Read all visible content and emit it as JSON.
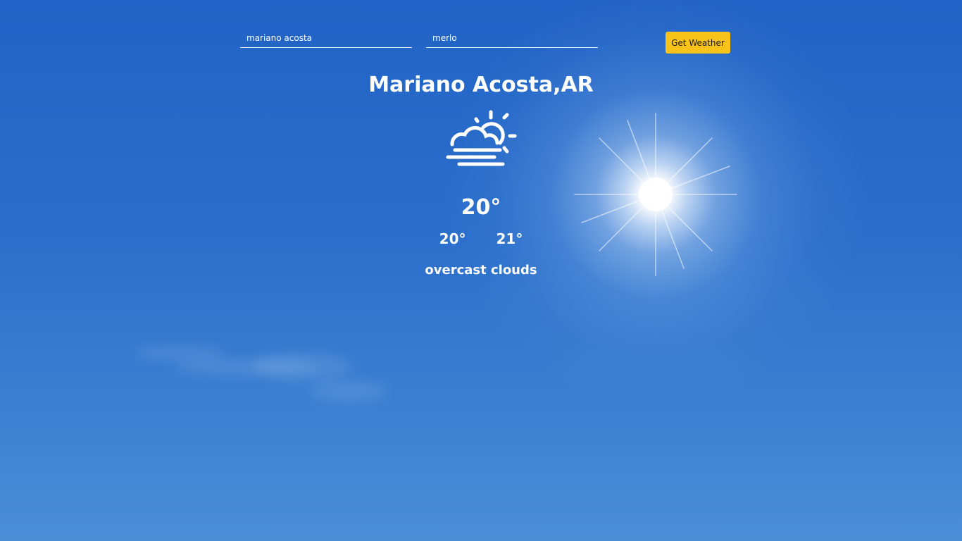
{
  "search": {
    "city_value": "mariano acosta",
    "country_value": "merlo",
    "button_label": "Get Weather"
  },
  "weather": {
    "location": "Mariano Acosta,AR",
    "icon": "cloud-sun-fog-icon",
    "temperature": "20°",
    "temp_min": "20°",
    "temp_max": "21°",
    "description": "overcast clouds"
  },
  "colors": {
    "sky_top": "#2163c6",
    "sky_bottom": "#4a8fd6",
    "button_bg": "#f7c21a",
    "text": "#ffffff"
  }
}
